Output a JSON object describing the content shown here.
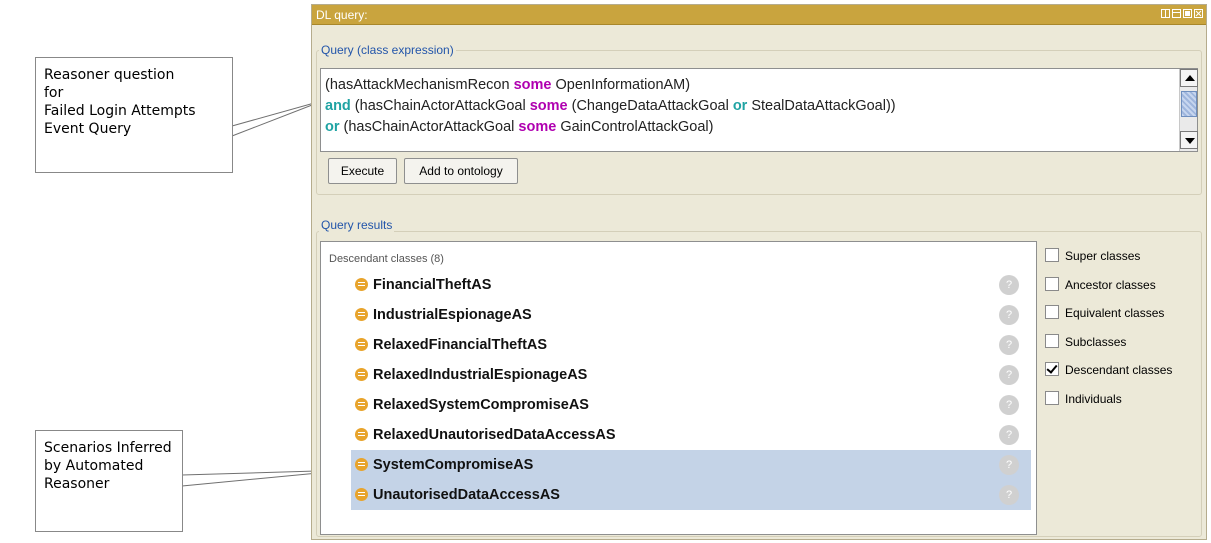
{
  "window": {
    "title": "DL query:"
  },
  "query": {
    "legend": "Query (class expression)",
    "lines": [
      [
        {
          "t": "(hasAttackMechanismRecon ",
          "k": ""
        },
        {
          "t": "some",
          "k": "p"
        },
        {
          "t": " OpenInformationAM)",
          "k": ""
        }
      ],
      [
        {
          "t": "and",
          "k": "t"
        },
        {
          "t": " (hasChainActorAttackGoal ",
          "k": ""
        },
        {
          "t": "some",
          "k": "p"
        },
        {
          "t": " (ChangeDataAttackGoal ",
          "k": ""
        },
        {
          "t": "or",
          "k": "t"
        },
        {
          "t": " StealDataAttackGoal))",
          "k": ""
        }
      ],
      [
        {
          "t": "or",
          "k": "t"
        },
        {
          "t": " (hasChainActorAttackGoal ",
          "k": ""
        },
        {
          "t": "some",
          "k": "p"
        },
        {
          "t": " GainControlAttackGoal)",
          "k": ""
        }
      ]
    ],
    "execute_label": "Execute",
    "add_label": "Add to ontology"
  },
  "results": {
    "legend": "Query results",
    "header": "Descendant classes (8)",
    "items": [
      {
        "label": "FinancialTheftAS",
        "selected": false
      },
      {
        "label": "IndustrialEspionageAS",
        "selected": false
      },
      {
        "label": "RelaxedFinancialTheftAS",
        "selected": false
      },
      {
        "label": "RelaxedIndustrialEspionageAS",
        "selected": false
      },
      {
        "label": "RelaxedSystemCompromiseAS",
        "selected": false
      },
      {
        "label": "RelaxedUnautorisedDataAccessAS",
        "selected": false
      },
      {
        "label": "SystemCompromiseAS",
        "selected": true
      },
      {
        "label": "UnautorisedDataAccessAS",
        "selected": true
      }
    ],
    "help_glyph": "?",
    "options": [
      {
        "label": "Super classes",
        "checked": false
      },
      {
        "label": "Ancestor classes",
        "checked": false
      },
      {
        "label": "Equivalent classes",
        "checked": false
      },
      {
        "label": "Subclasses",
        "checked": false
      },
      {
        "label": "Descendant classes",
        "checked": true
      },
      {
        "label": "Individuals",
        "checked": false
      }
    ]
  },
  "callouts": {
    "query": [
      "Reasoner question",
      "for",
      "Failed Login Attempts",
      "Event Query"
    ],
    "results": [
      "Scenarios Inferred",
      "by Automated",
      "Reasoner"
    ]
  },
  "colors": {
    "titlebar": "#c9a43e",
    "keyword_purple": "#b000b0",
    "keyword_teal": "#1fa3a3",
    "selected_row": "#c4d3e7",
    "legend_text": "#2255aa",
    "class_icon": "#e8a42c"
  },
  "icons": {
    "window_controls": [
      "tile-icon",
      "minimize-icon",
      "maximize-icon",
      "close-icon"
    ],
    "class": "class-icon",
    "help": "help-icon",
    "scroll": [
      "scroll-up-icon",
      "scroll-down-icon"
    ]
  }
}
